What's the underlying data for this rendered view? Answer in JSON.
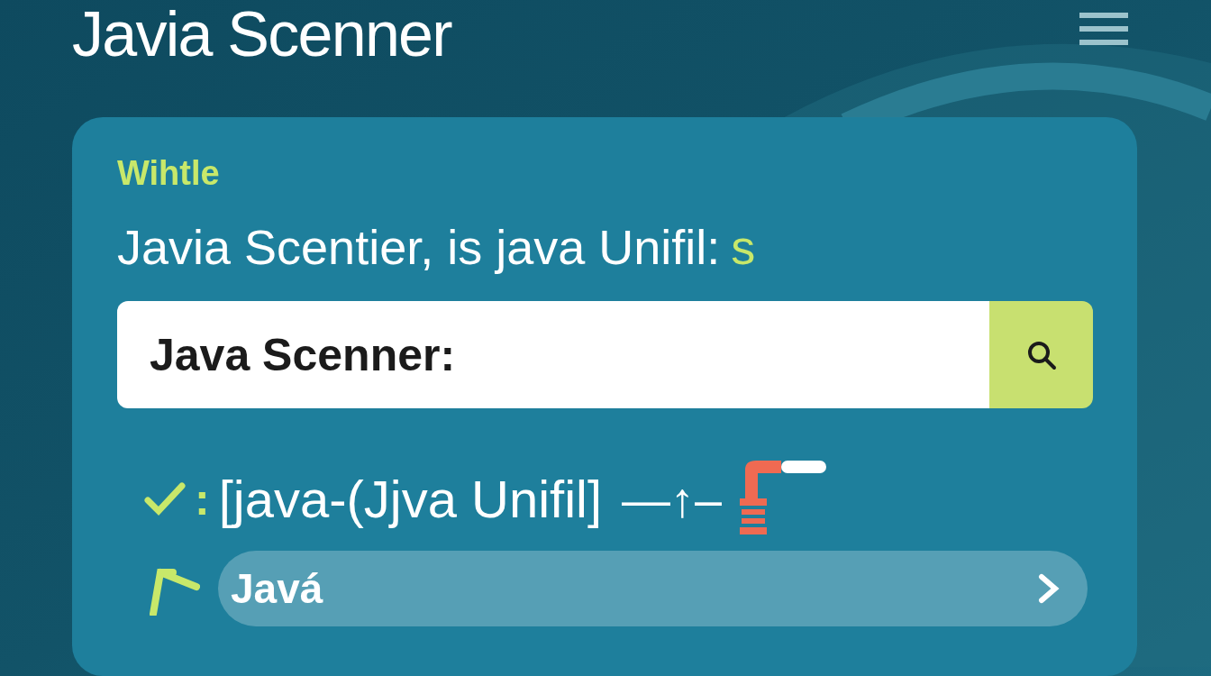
{
  "header": {
    "title": "Javia Scenner"
  },
  "card": {
    "label": "Wihtle",
    "headline": "Javia Scentier, is java Unifil:",
    "headline_accent": "s",
    "search": {
      "value": "Java Scenner:"
    },
    "result": {
      "separator": ":",
      "text": "[java-(Jjva Unifil]",
      "trail": "—↑–"
    },
    "suggestion": {
      "label": "Javá"
    }
  }
}
